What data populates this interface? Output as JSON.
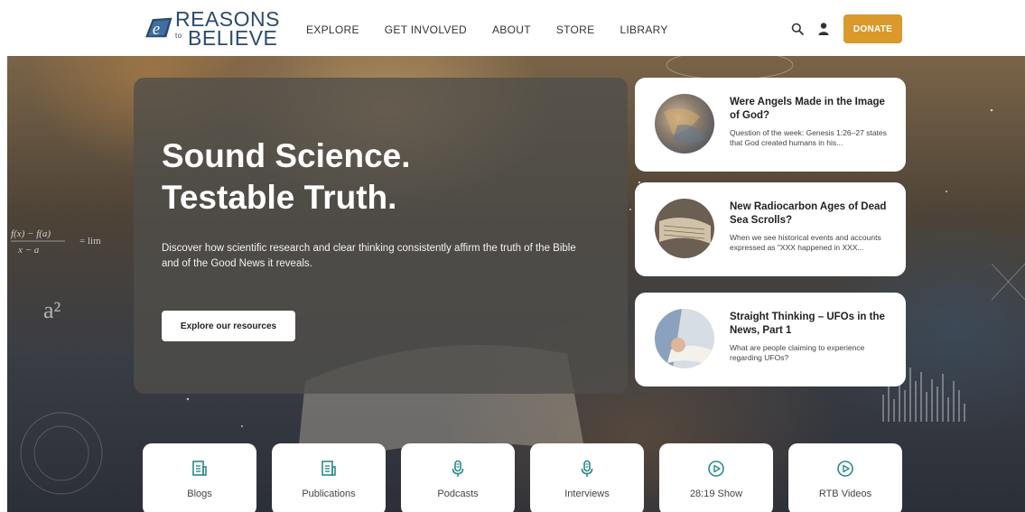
{
  "brand": {
    "line1": "REASONS",
    "to": "to",
    "line2": "BELIEVE",
    "color": "#2c4a6e"
  },
  "nav": {
    "items": [
      "EXPLORE",
      "GET INVOLVED",
      "ABOUT",
      "STORE",
      "LIBRARY"
    ],
    "donate": "DONATE",
    "donate_color": "#d99a2b"
  },
  "hero": {
    "title_line1": "Sound Science.",
    "title_line2": "Testable Truth.",
    "description": "Discover how scientific research and clear thinking consistently affirm the truth of the Bible and of the Good News it reveals.",
    "button": "Explore our resources",
    "formula_left": "f(x) − f(a)",
    "formula_left_denominator": "x − a",
    "formula_lim": "= lim",
    "formula_a2": "a²"
  },
  "cards": [
    {
      "title": "Were Angels Made in the Image of God?",
      "excerpt": "Question of the week: Genesis 1:26–27 states that God created humans in his..."
    },
    {
      "title": "New Radiocarbon Ages of Dead Sea Scrolls?",
      "excerpt": "When we see historical events and accounts expressed as \"XXX happened in XXX..."
    },
    {
      "title": "Straight Thinking – UFOs in the News, Part 1",
      "excerpt": "What are people claiming to experience regarding UFOs?"
    }
  ],
  "tiles": [
    {
      "label": "Blogs",
      "icon": "document-icon"
    },
    {
      "label": "Publications",
      "icon": "document-icon"
    },
    {
      "label": "Podcasts",
      "icon": "microphone-icon"
    },
    {
      "label": "Interviews",
      "icon": "microphone-icon"
    },
    {
      "label": "28:19 Show",
      "icon": "play-circle-icon"
    },
    {
      "label": "RTB Videos",
      "icon": "play-circle-icon"
    }
  ],
  "accent": "#2b8a8a"
}
